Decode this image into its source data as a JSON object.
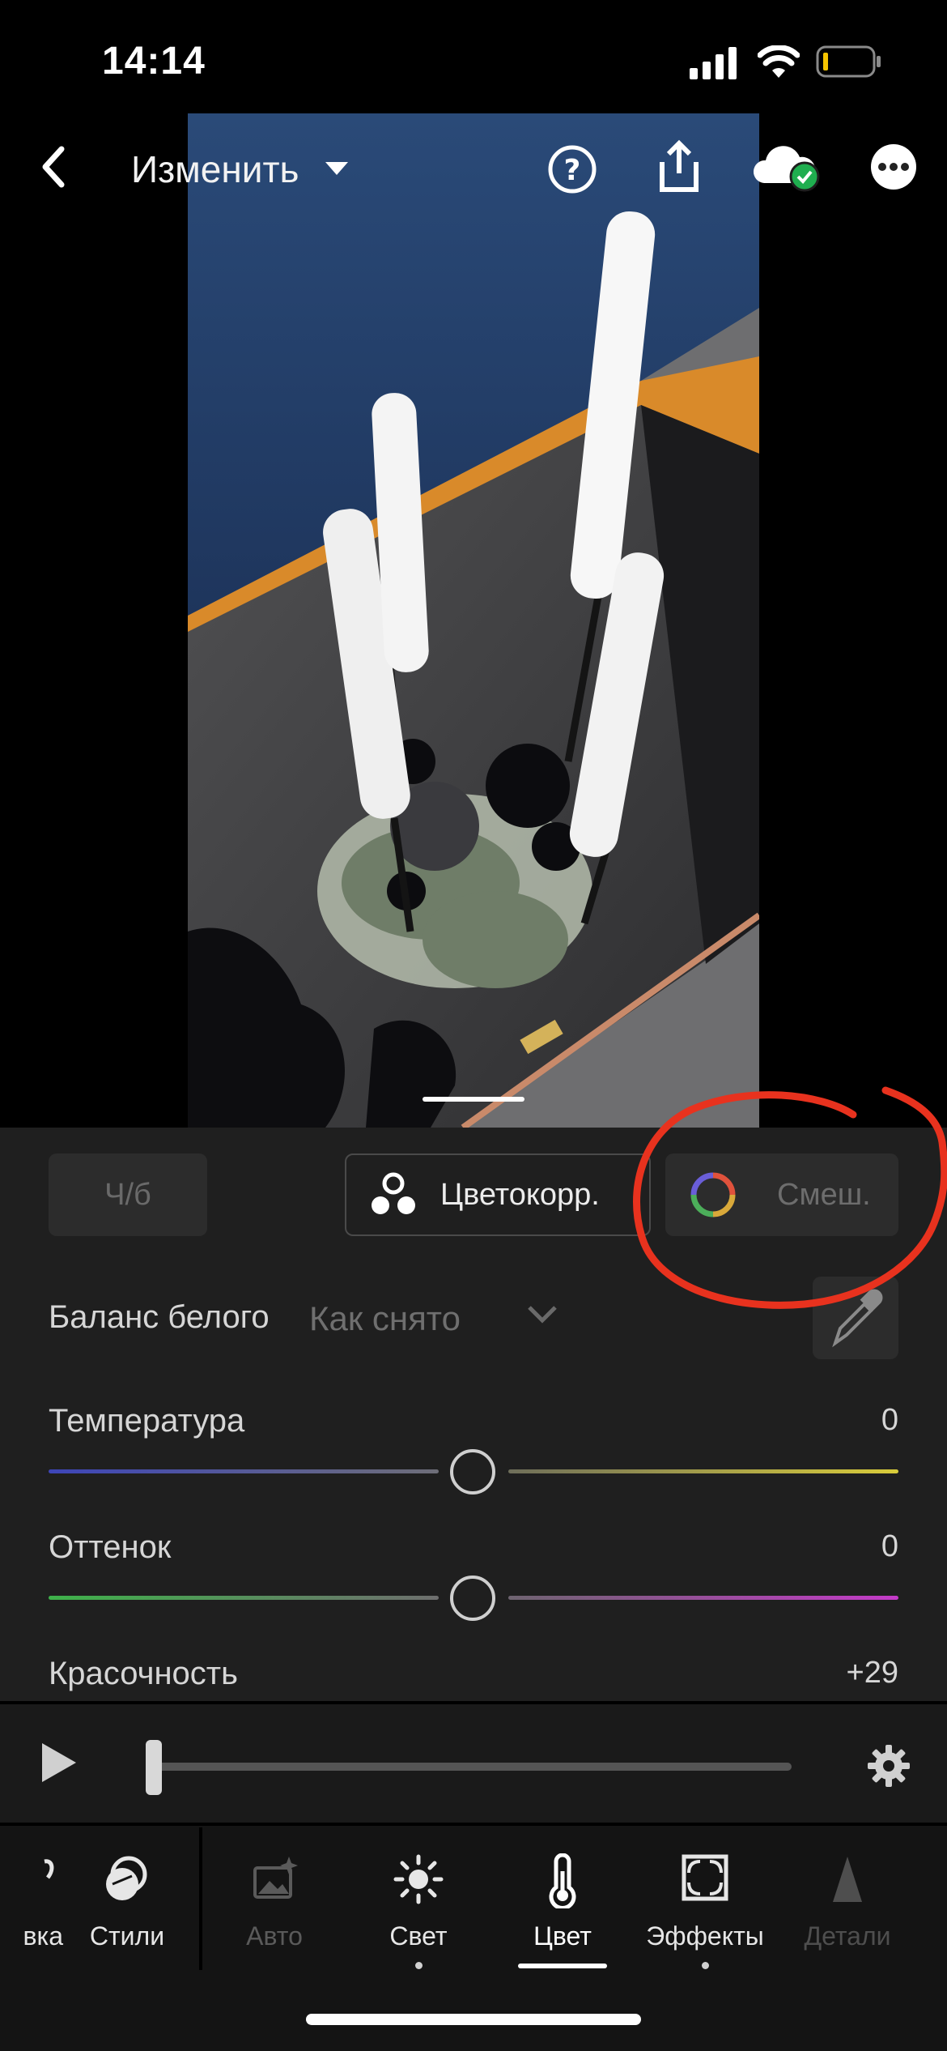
{
  "status": {
    "time": "14:14"
  },
  "header": {
    "title": "Изменить"
  },
  "panel": {
    "bw_label": "Ч/б",
    "color_grading_label": "Цветокорр.",
    "mix_label": "Смеш.",
    "white_balance_label": "Баланс белого",
    "white_balance_value": "Как снято",
    "sliders": [
      {
        "label": "Температура",
        "value": "0"
      },
      {
        "label": "Оттенок",
        "value": "0"
      },
      {
        "label": "Красочность",
        "value": "+29"
      }
    ]
  },
  "tabs": [
    {
      "label": "вка"
    },
    {
      "label": "Стили"
    },
    {
      "label": "Авто"
    },
    {
      "label": "Свет"
    },
    {
      "label": "Цвет"
    },
    {
      "label": "Эффекты"
    },
    {
      "label": "Детали"
    }
  ],
  "colors": {
    "accent_annotation": "#e8321e",
    "panel_bg": "#1f1f1f"
  }
}
